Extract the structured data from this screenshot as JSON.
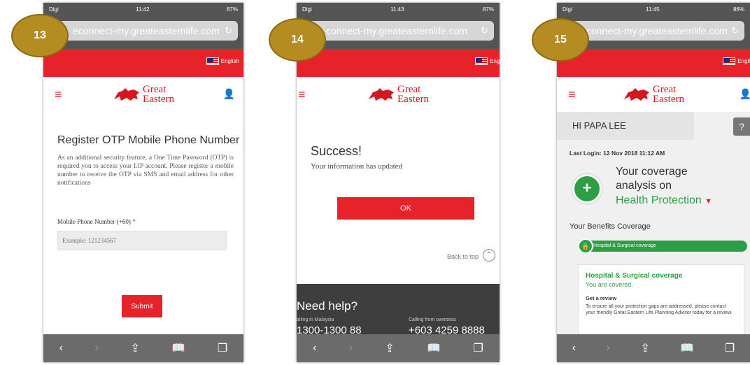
{
  "common": {
    "url": "econnect-my.greateasternlife.com",
    "language": "English",
    "logo_line1": "Great",
    "logo_line2": "Eastern",
    "colors": {
      "brand_red": "#e8222b",
      "green": "#2e9e45",
      "badge_gold": "#b48c21"
    }
  },
  "screens": [
    {
      "badge": "13",
      "status": {
        "carrier": "Digi",
        "time": "11:42",
        "battery": "87%"
      },
      "url": "econnect-my.greateasternlife.com",
      "title": "Register OTP Mobile Phone Number",
      "description": "As an additional security feature, a One Time Password (OTP) is required you to access your LIP account. Please register a mobile number to receive the OTP via SMS and email address for other notifications",
      "field_label": "Mobile Phone Number (+60)",
      "field_required": "*",
      "field_placeholder": "Example: 121234567",
      "submit_label": "Submit"
    },
    {
      "badge": "14",
      "status": {
        "carrier": "Digi",
        "time": "11:43",
        "battery": "87%"
      },
      "url": "connect-my.greateasternlife.com",
      "language": "Engl",
      "title": "Success!",
      "message": "Your information has updated",
      "ok_label": "OK",
      "back_to_top": "Back to top",
      "help_title": "Need help?",
      "call_local_label": "alling in Malaysia",
      "call_local_number": "1300-1300 88",
      "call_overseas_label": "Calling from overseas",
      "call_overseas_number": "+603 4259 8888"
    },
    {
      "badge": "15",
      "status": {
        "carrier": "Digi",
        "time": "11:45",
        "battery": "86%"
      },
      "url": "connect-my.greateasternlife.com",
      "language": "Englis",
      "greeting": "HI PAPA LEE",
      "last_login": "Last Login: 12 Nov 2018 11:12 AM",
      "coverage_line1": "Your coverage",
      "coverage_line2": "analysis on",
      "coverage_line3": "Health Protection",
      "benefits_title": "Your Benefits Coverage",
      "pill_label": "Hospital & Surgical coverage",
      "card_title": "Hospital & Surgical coverage",
      "card_status": "You are covered.",
      "card_heading": "Get a review",
      "card_text": "To ensure all your protection gaps are addressed, please contact your friendly Great Eastern Life Planning Advisor today for a review.",
      "health_icon_label": "HEALTH"
    }
  ],
  "icons": {
    "menu": "≡",
    "user": "👤",
    "reload": "↻",
    "back": "‹",
    "forward": "›",
    "share": "⇪",
    "bookmarks": "📖",
    "tabs": "❐",
    "caret": "▼",
    "lock": "🔒",
    "chevron_up": "⌃",
    "help": "?"
  }
}
